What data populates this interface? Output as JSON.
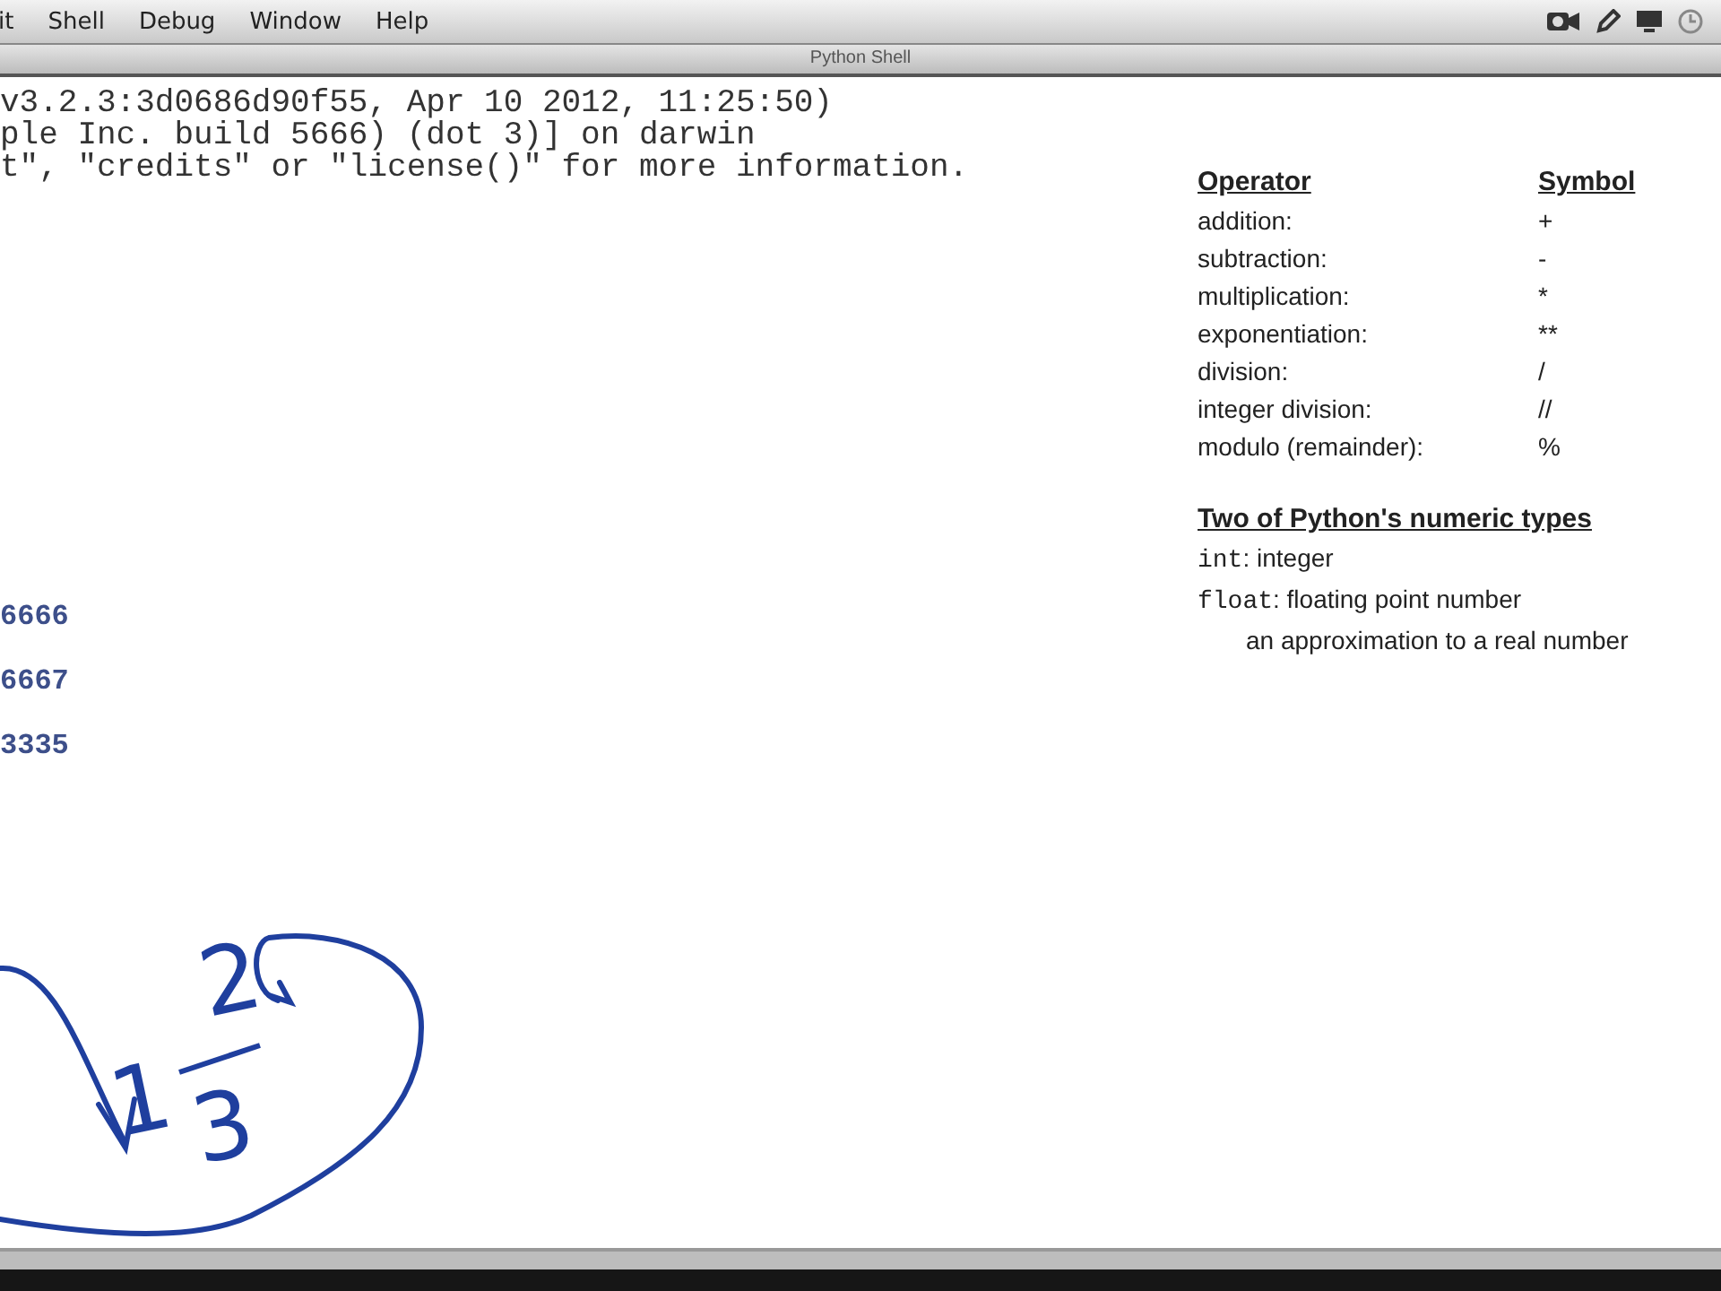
{
  "menu_bar": {
    "items": [
      "it",
      "Shell",
      "Debug",
      "Window",
      "Help"
    ]
  },
  "window": {
    "title": "Python Shell"
  },
  "shell": {
    "output": [
      "v3.2.3:3d0686d90f55, Apr 10 2012, 11:25:50)",
      "ple Inc. build 5666) (dot 3)] on darwin",
      "t\", \"credits\" or \"license()\" for more information."
    ],
    "results": [
      "6666",
      "6667",
      "3335"
    ]
  },
  "operators": {
    "columns": [
      "Operator",
      "Symbol"
    ],
    "rows": [
      {
        "name": "addition:",
        "symbol": "+"
      },
      {
        "name": "subtraction:",
        "symbol": "-"
      },
      {
        "name": "multiplication:",
        "symbol": "*"
      },
      {
        "name": "exponentiation:",
        "symbol": "**"
      },
      {
        "name": "division:",
        "symbol": "/"
      },
      {
        "name": "integer division:",
        "symbol": "//"
      },
      {
        "name": "modulo (remainder):",
        "symbol": "%"
      }
    ]
  },
  "numeric_types": {
    "title": "Two of Python's numeric types",
    "items": [
      {
        "code": "int",
        "text": ": integer"
      },
      {
        "code": "float",
        "text": ": floating point number"
      }
    ],
    "note": "an approximation to a real number"
  },
  "annotation": {
    "marks": [
      "1",
      "2",
      "3"
    ]
  }
}
